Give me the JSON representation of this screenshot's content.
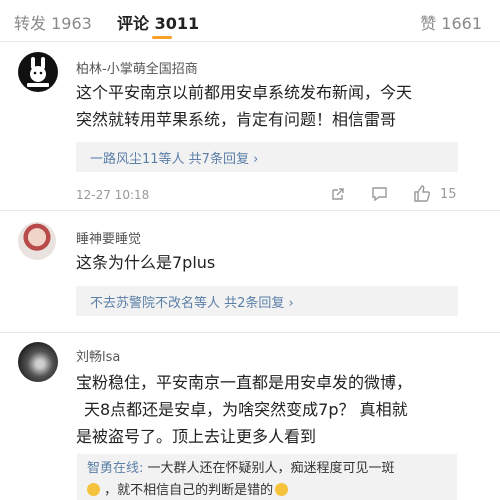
{
  "tabs": {
    "repost": "转发 1963",
    "comment": "评论 3011",
    "like": "赞 1661"
  },
  "comments": [
    {
      "user": "柏林-小掌萌全国招商",
      "text_lines": [
        "这个平安南京以前都用安卓系统发布新闻，今天",
        "突然就转用苹果系统，肯定有问题！相信雷哥"
      ],
      "replies": "一路风尘11等人 共7条回复 ›",
      "time": "12-27 10:18",
      "likes": "15"
    },
    {
      "user": "睡神要睡觉",
      "text_lines": [
        "这条为什么是7plus"
      ],
      "replies": "不去苏警院不改名等人 共2条回复 ›"
    },
    {
      "user": "刘畅lsa",
      "text_lines": [
        "宝粉稳住，平安南京一直都是用安卓发的微博，",
        "天8点都还是安卓，为啥突然变成7p？ 真相就",
        "是被盗号了。顶上去让更多人看到"
      ],
      "quote_name": "智勇在线:",
      "quote_line1": " 一大群人还在怀疑别人，痴迷程度可见一斑",
      "quote_line2": " ，就不相信自己的判断是错的"
    }
  ],
  "icons": {
    "share": "share-icon",
    "comment": "comment-icon",
    "like": "thumbs-up-icon"
  }
}
